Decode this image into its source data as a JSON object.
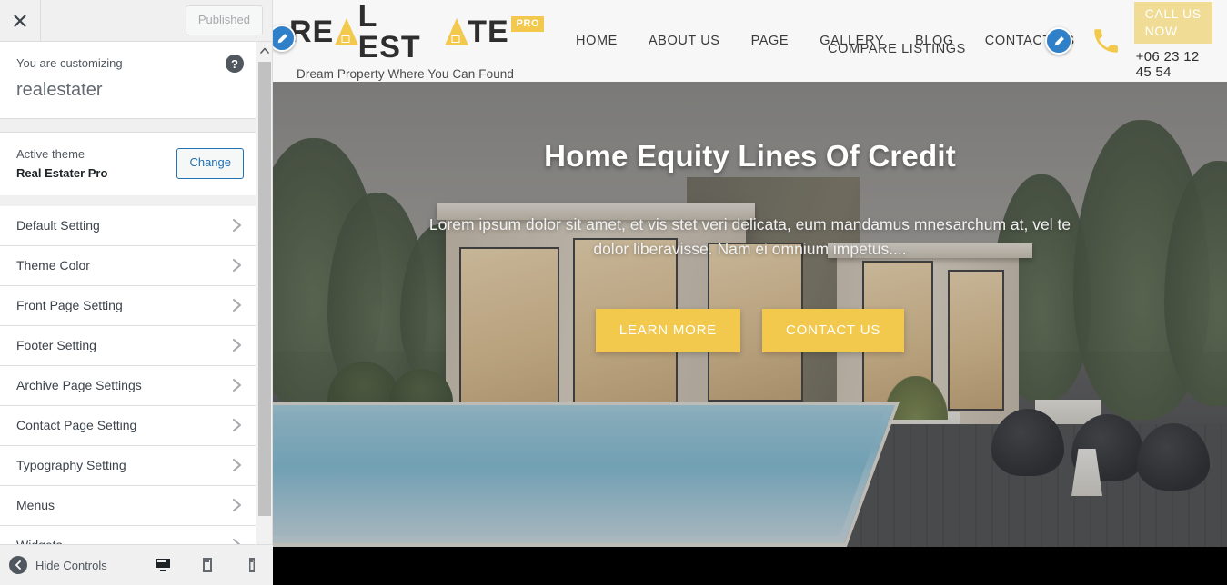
{
  "customizer": {
    "close_label": "Close",
    "publish_label": "Published",
    "customizing_label": "You are customizing",
    "site_title": "realestater",
    "help_label": "?",
    "active_theme_label": "Active theme",
    "active_theme_name": "Real Estater Pro",
    "change_label": "Change",
    "sections": [
      {
        "label": "Default Setting"
      },
      {
        "label": "Theme Color"
      },
      {
        "label": "Front Page Setting"
      },
      {
        "label": "Footer Setting"
      },
      {
        "label": "Archive Page Settings"
      },
      {
        "label": "Contact Page Setting"
      },
      {
        "label": "Typography Setting"
      },
      {
        "label": "Menus"
      },
      {
        "label": "Widgets"
      }
    ],
    "footer": {
      "hide_controls_label": "Hide Controls",
      "devices": [
        {
          "name": "desktop",
          "active": true
        },
        {
          "name": "tablet",
          "active": false
        },
        {
          "name": "mobile",
          "active": false
        }
      ]
    }
  },
  "preview": {
    "logo": {
      "word_one": "RE",
      "word_two": "L EST",
      "word_three": "TE",
      "badge": "PRO",
      "tagline": "Dream Property Where You Can Found"
    },
    "nav": {
      "items": [
        {
          "label": "HOME"
        },
        {
          "label": "ABOUT US"
        },
        {
          "label": "PAGE"
        },
        {
          "label": "GALLERY"
        },
        {
          "label": "BLOG"
        },
        {
          "label": "CONTACT US"
        }
      ],
      "sub_item": "COMPARE LISTINGS"
    },
    "call": {
      "button_label": "CALL US NOW",
      "number": "+06 23 12 45 54"
    },
    "hero": {
      "title": "Home Equity Lines Of Credit",
      "description": "Lorem ipsum dolor sit amet, et vis stet veri delicata, eum mandamus mnesarchum at, vel te dolor liberavisse. Nam ei omnium impetus....",
      "primary_button": "LEARN MORE",
      "secondary_button": "CONTACT US"
    }
  },
  "colors": {
    "accent_yellow": "#f2c94c",
    "call_button": "#f0dc94",
    "wp_blue": "#2271b1",
    "edit_shortcut_blue": "#2f80c9",
    "sidebar_bg": "#f0f0f1",
    "header_bg": "#f7f7f7"
  }
}
